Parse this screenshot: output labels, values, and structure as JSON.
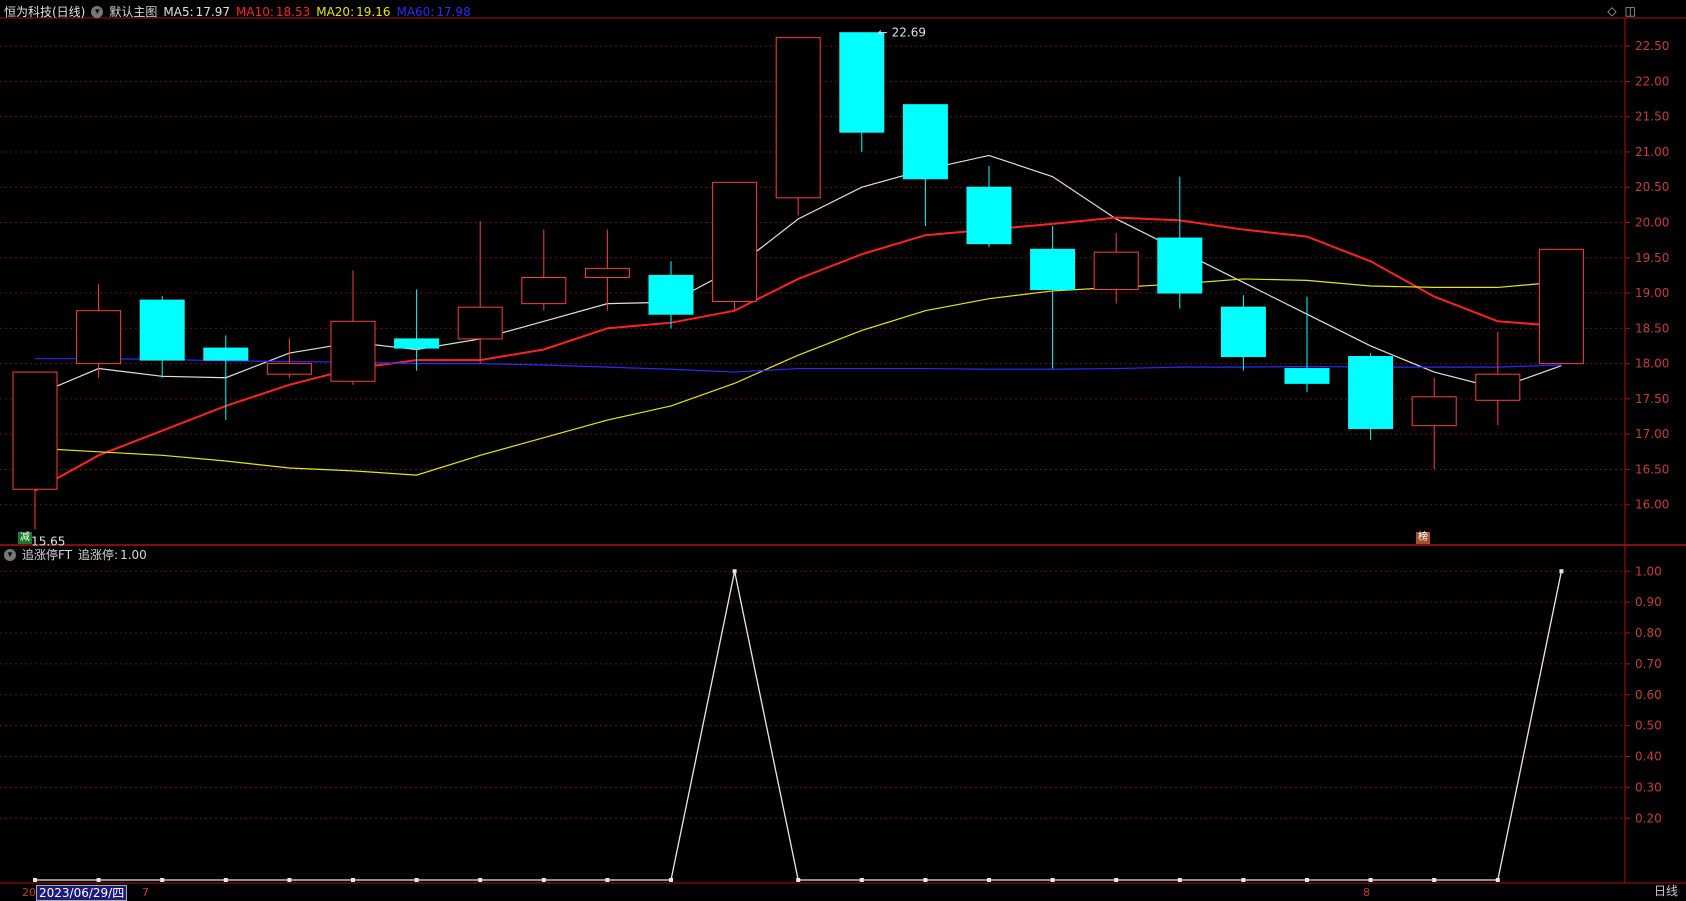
{
  "header": {
    "title": "恒为科技(日线)",
    "template_label": "默认主图",
    "ma": [
      {
        "label": "MA5:",
        "value": "17.97",
        "color": "#e0e0e0"
      },
      {
        "label": "MA10:",
        "value": "18.53",
        "color": "#ff2020"
      },
      {
        "label": "MA20:",
        "value": "19.16",
        "color": "#e8e800"
      },
      {
        "label": "MA60:",
        "value": "17.98",
        "color": "#2a2aff"
      }
    ]
  },
  "indicator_header": {
    "name": "追涨停FT",
    "label": "追涨停:",
    "value": "1.00"
  },
  "icons": [
    "diamond-icon",
    "window-toggle-icon",
    "collapse-circle-icon"
  ],
  "tags": {
    "left_tag": "减",
    "right_tag": "榜"
  },
  "footer": {
    "date": "2023/06/29/四",
    "left_digit": "20",
    "mid_digit": "7",
    "right_digit": "8",
    "period_label": "日线"
  },
  "colors": {
    "up": "#ff3b3b",
    "down": "#00ffff",
    "ma5": "#e0e0e0",
    "ma10": "#ff2020",
    "ma20": "#e8e800",
    "ma60": "#2a2aff",
    "grid": "#6a1010",
    "axis": "#b01010"
  },
  "chart_data": [
    {
      "type": "candlestick",
      "title": "",
      "annotations": [
        {
          "text": "22.69",
          "kind": "high"
        },
        {
          "text": "15.65",
          "kind": "low"
        }
      ],
      "ylim": [
        15.5,
        22.7
      ],
      "yticks": [
        "22.50",
        "22.00",
        "21.50",
        "21.00",
        "20.50",
        "20.00",
        "19.50",
        "19.00",
        "18.50",
        "18.00",
        "17.50",
        "17.00",
        "16.50",
        "16.00"
      ],
      "candles": [
        {
          "o": 16.22,
          "h": 17.88,
          "l": 15.65,
          "c": 17.88
        },
        {
          "o": 18.0,
          "h": 19.13,
          "l": 17.8,
          "c": 18.75
        },
        {
          "o": 18.9,
          "h": 18.96,
          "l": 17.8,
          "c": 18.05
        },
        {
          "o": 18.22,
          "h": 18.4,
          "l": 17.2,
          "c": 18.05
        },
        {
          "o": 17.85,
          "h": 18.36,
          "l": 17.8,
          "c": 18.0
        },
        {
          "o": 17.75,
          "h": 19.32,
          "l": 17.7,
          "c": 18.6
        },
        {
          "o": 18.35,
          "h": 19.05,
          "l": 17.9,
          "c": 18.22
        },
        {
          "o": 18.35,
          "h": 20.02,
          "l": 18.0,
          "c": 18.8
        },
        {
          "o": 18.85,
          "h": 19.9,
          "l": 18.75,
          "c": 19.22
        },
        {
          "o": 19.22,
          "h": 19.9,
          "l": 18.75,
          "c": 19.35
        },
        {
          "o": 19.25,
          "h": 19.45,
          "l": 18.5,
          "c": 18.7
        },
        {
          "o": 18.88,
          "h": 20.57,
          "l": 18.75,
          "c": 20.57
        },
        {
          "o": 20.35,
          "h": 22.62,
          "l": 20.1,
          "c": 22.62
        },
        {
          "o": 22.69,
          "h": 22.69,
          "l": 21.0,
          "c": 21.28
        },
        {
          "o": 21.67,
          "h": 21.67,
          "l": 19.95,
          "c": 20.62
        },
        {
          "o": 20.5,
          "h": 20.8,
          "l": 19.65,
          "c": 19.7
        },
        {
          "o": 19.62,
          "h": 19.95,
          "l": 17.93,
          "c": 19.05
        },
        {
          "o": 19.05,
          "h": 19.85,
          "l": 18.85,
          "c": 19.58
        },
        {
          "o": 19.78,
          "h": 20.65,
          "l": 18.78,
          "c": 19.0
        },
        {
          "o": 18.8,
          "h": 18.97,
          "l": 17.9,
          "c": 18.1
        },
        {
          "o": 17.93,
          "h": 18.95,
          "l": 17.6,
          "c": 17.72
        },
        {
          "o": 18.1,
          "h": 18.15,
          "l": 16.92,
          "c": 17.08
        },
        {
          "o": 17.12,
          "h": 17.8,
          "l": 16.5,
          "c": 17.53
        },
        {
          "o": 17.48,
          "h": 18.45,
          "l": 17.13,
          "c": 17.85
        },
        {
          "o": 18.0,
          "h": 19.62,
          "l": 18.0,
          "c": 19.62
        }
      ],
      "series": [
        {
          "name": "MA5",
          "values": [
            17.55,
            17.93,
            17.82,
            17.8,
            18.15,
            18.3,
            18.2,
            18.35,
            18.6,
            18.85,
            18.87,
            19.35,
            20.05,
            20.5,
            20.75,
            20.95,
            20.65,
            20.05,
            19.6,
            19.15,
            18.7,
            18.25,
            17.88,
            17.65,
            17.97
          ]
        },
        {
          "name": "MA10",
          "values": [
            16.2,
            16.7,
            17.05,
            17.4,
            17.7,
            17.93,
            18.05,
            18.05,
            18.2,
            18.5,
            18.58,
            18.75,
            19.2,
            19.55,
            19.82,
            19.9,
            19.98,
            20.07,
            20.03,
            19.9,
            19.8,
            19.45,
            18.95,
            18.6,
            18.53
          ]
        },
        {
          "name": "MA20",
          "values": [
            16.8,
            16.75,
            16.7,
            16.62,
            16.52,
            16.48,
            16.42,
            16.7,
            16.95,
            17.2,
            17.4,
            17.72,
            18.12,
            18.47,
            18.75,
            18.92,
            19.03,
            19.08,
            19.13,
            19.2,
            19.18,
            19.1,
            19.08,
            19.08,
            19.16
          ]
        },
        {
          "name": "MA60",
          "values": [
            18.07,
            18.07,
            18.06,
            18.04,
            18.03,
            18.02,
            18.0,
            18.0,
            17.98,
            17.95,
            17.92,
            17.88,
            17.93,
            17.93,
            17.93,
            17.92,
            17.92,
            17.93,
            17.95,
            17.95,
            17.96,
            17.95,
            17.95,
            17.95,
            17.98
          ]
        }
      ]
    },
    {
      "type": "line",
      "title": "",
      "ylim": [
        0,
        1.03
      ],
      "yticks": [
        "1.00",
        "0.90",
        "0.80",
        "0.70",
        "0.60",
        "0.50",
        "0.40",
        "0.30",
        "0.20"
      ],
      "series": [
        {
          "name": "追涨停",
          "values": [
            0,
            0,
            0,
            0,
            0,
            0,
            0,
            0,
            0,
            0,
            0,
            1,
            0,
            0,
            0,
            0,
            0,
            0,
            0,
            0,
            0,
            0,
            0,
            0,
            1
          ]
        }
      ]
    }
  ]
}
